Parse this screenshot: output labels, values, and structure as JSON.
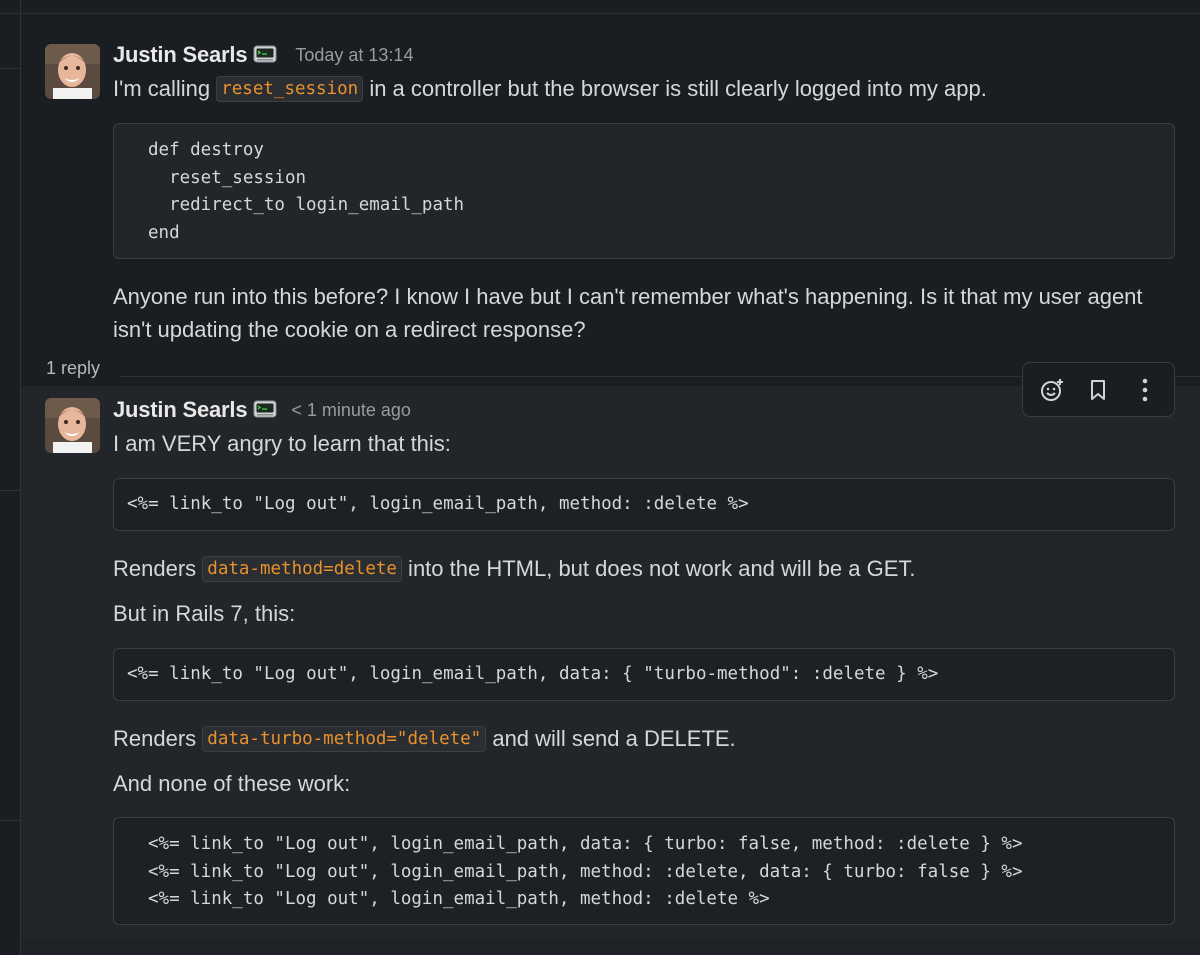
{
  "message1": {
    "sender": "Justin Searls",
    "status_icon": "computer-terminal-icon",
    "timestamp": "Today at 13:14",
    "text_before": "I'm calling ",
    "inline_code": "reset_session",
    "text_after": " in a controller but the browser is still clearly logged into my app.",
    "code": "def destroy\n  reset_session\n  redirect_to login_email_path\nend",
    "paragraph_line1": "Anyone run into this before? I know I have but I can't remember what's happening. Is it that my user agent",
    "paragraph_line2": "isn't updating the cookie on a redirect response?"
  },
  "thread": {
    "reply_count": "1 reply"
  },
  "toolbar": {
    "add_reaction": "add-reaction-icon",
    "save": "bookmark-icon",
    "more": "more-actions-icon"
  },
  "message2": {
    "sender": "Justin Searls",
    "timestamp": "< 1 minute ago",
    "intro": "I am VERY angry to learn that this:",
    "code1": "<%= link_to \"Log out\", login_email_path, method: :delete %>",
    "renders1_before": "Renders ",
    "renders1_code": "data-method=delete",
    "renders1_after": " into the HTML, but does not work and will be a GET.",
    "rails7": "But in Rails 7, this:",
    "code2": "<%= link_to \"Log out\", login_email_path, data: { \"turbo-method\": :delete } %>",
    "renders2_before": "Renders ",
    "renders2_code": "data-turbo-method=\"delete\"",
    "renders2_after": " and will send a DELETE.",
    "none_work": "And none of these work:",
    "code3": "<%= link_to \"Log out\", login_email_path, data: { turbo: false, method: :delete } %>\n<%= link_to \"Log out\", login_email_path, method: :delete, data: { turbo: false } %>\n<%= link_to \"Log out\", login_email_path, method: :delete %>"
  },
  "colors": {
    "background": "#1a1d21",
    "thread_background": "#222529",
    "inline_code": "#e8912d",
    "text": "#d6d7d8"
  }
}
